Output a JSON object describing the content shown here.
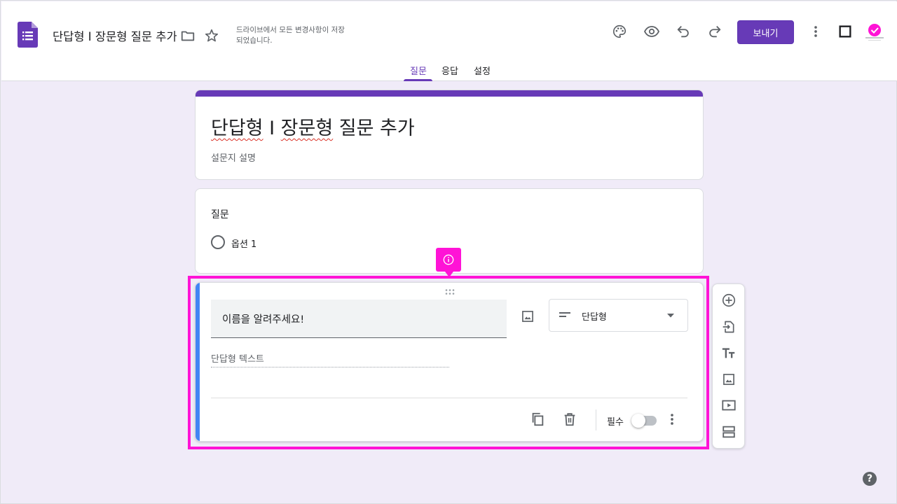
{
  "header": {
    "doc_title": "단답형 I 장문형 질문 추가",
    "save_status": "드라이브에서 모든 변경사항이 저장되었습니다.",
    "send_label": "보내기",
    "brand_color": "#673ab7",
    "icons": [
      "forms-logo-icon",
      "folder-icon",
      "star-icon",
      "palette-icon",
      "preview-eye-icon",
      "undo-icon",
      "redo-icon",
      "more-vert-icon",
      "square-icon",
      "avatar-badge"
    ]
  },
  "tabs": [
    {
      "label": "질문",
      "active": true
    },
    {
      "label": "응답",
      "active": false
    },
    {
      "label": "설정",
      "active": false
    }
  ],
  "form": {
    "title_part1": "단답형",
    "title_part2": " I ",
    "title_part3": "장문형",
    "title_part4": " 질문 추가",
    "description": "설문지 설명"
  },
  "question1": {
    "title": "질문",
    "option": "옵션 1"
  },
  "question2": {
    "title": "이름을 알려주세요!",
    "type": "단답형",
    "answer_placeholder": "단답형 텍스트",
    "required_label": "필수",
    "required": false,
    "accent_color": "#4285f4"
  },
  "side_toolbar": {
    "tools": [
      "add-question-icon",
      "import-questions-icon",
      "add-title-icon",
      "add-image-icon",
      "add-video-icon",
      "add-section-icon"
    ]
  },
  "annotation": {
    "highlight_color": "#ff13d6",
    "marker_icon": "info-icon"
  },
  "help": {
    "label": "?"
  }
}
